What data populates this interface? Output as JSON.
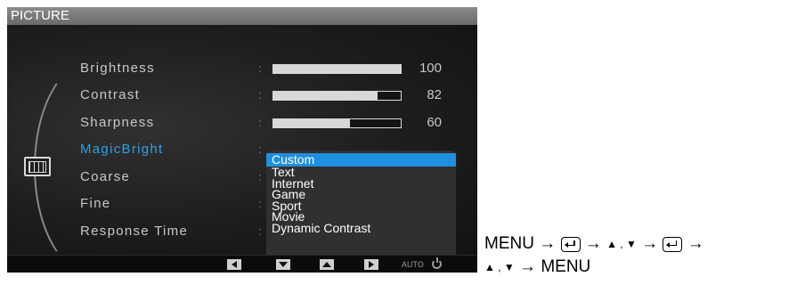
{
  "osd": {
    "title": "PICTURE",
    "icon": "picture-icon",
    "menu_items": [
      {
        "label": "Brightness",
        "value": "100",
        "level": 100
      },
      {
        "label": "Contrast",
        "value": "82",
        "level": 82
      },
      {
        "label": "Sharpness",
        "value": "60",
        "level": 60
      },
      {
        "label": "MagicBright",
        "active": true
      },
      {
        "label": "Coarse"
      },
      {
        "label": "Fine"
      },
      {
        "label": "Response Time"
      }
    ],
    "separator": ":",
    "magicbright_options": [
      "Custom",
      "Text",
      "Internet",
      "Game",
      "Sport",
      "Movie",
      "Dynamic Contrast"
    ],
    "magicbright_selected": "Custom",
    "bottom_bar": {
      "buttons": [
        "left-arrow-icon",
        "down-arrow-icon",
        "up-arrow-icon",
        "right-arrow-icon"
      ],
      "auto_label": "AUTO",
      "power_icon": "power-icon"
    },
    "accent_color": "#2aa0e8",
    "selection_color": "#1e90e0"
  },
  "instructions": {
    "line1": {
      "menu": "MENU",
      "arrow": "→",
      "updown": "▲ , ▼"
    },
    "line2": {
      "updown": "▲ , ▼",
      "arrow": "→",
      "menu": "MENU"
    },
    "enter_icon": "enter-key-icon"
  }
}
